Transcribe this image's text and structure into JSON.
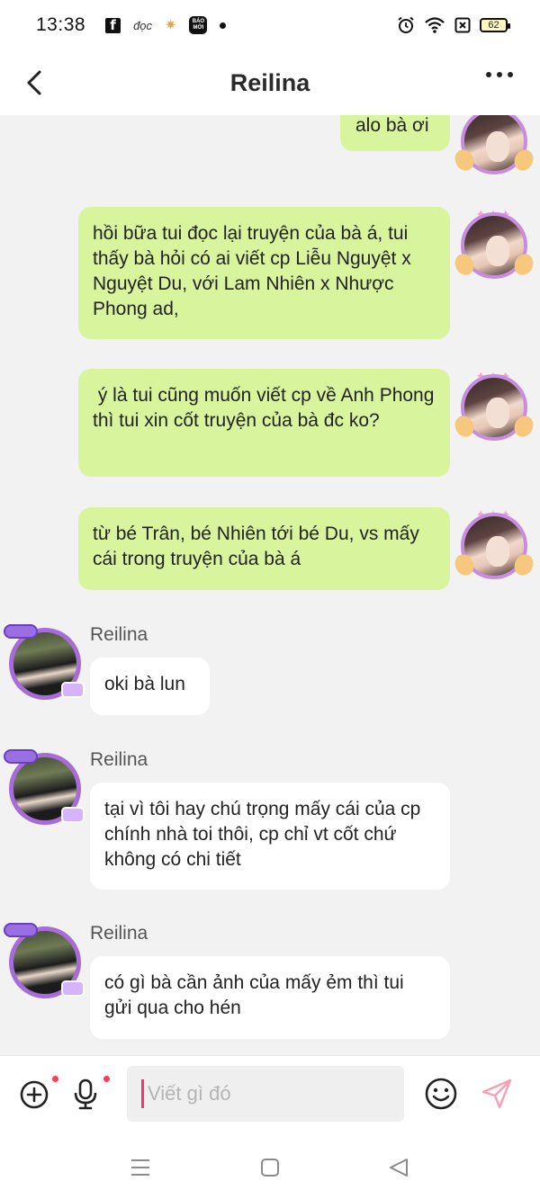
{
  "status_bar": {
    "time": "13:38",
    "app_icon_fb": "f",
    "app_icon_text": "đọc",
    "app_icon_bao_line1": "BÁO",
    "app_icon_bao_line2": "MỚI",
    "battery": "62"
  },
  "header": {
    "title": "Reilina"
  },
  "messages_out": [
    {
      "text": "alo bà ơi"
    },
    {
      "text": "hồi bữa tui đọc lại truyện của bà á, tui thấy bà hỏi có ai viết cp Liễu Nguyệt x Nguyệt Du, với Lam Nhiên x Nhược Phong ad,"
    },
    {
      "text": " ý là tui cũng muốn viết cp về Anh Phong thì tui xin cốt truyện của bà đc ko?"
    },
    {
      "text": "từ bé Trân, bé Nhiên tới bé Du, vs mấy cái trong truyện của bà á"
    }
  ],
  "messages_in": [
    {
      "sender": "Reilina",
      "text": "oki bà lun"
    },
    {
      "sender": "Reilina",
      "text": "tại vì tôi hay chú trọng mấy cái của cp chính nhà toi thôi, cp chỉ vt cốt chứ không có chi tiết"
    },
    {
      "sender": "Reilina",
      "text": "có gì bà cần ảnh của mấy ẻm thì tui gửi qua cho hén"
    }
  ],
  "composer": {
    "placeholder": "Viết gì đó"
  },
  "colors": {
    "outgoing_bubble": "#d8f59e",
    "incoming_bubble": "#ffffff",
    "accent": "#ff2e78",
    "notification_dot": "#ff3b5c"
  }
}
